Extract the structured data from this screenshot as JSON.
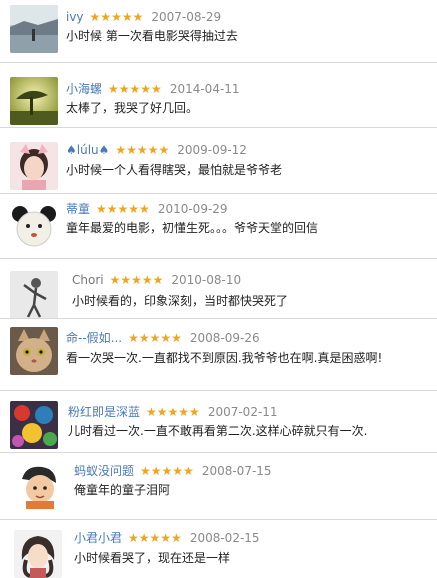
{
  "reviews": [
    {
      "user": "ivy",
      "stars": "★★★★★",
      "date": "2007-08-29",
      "comment": "小时候 第一次看电影哭得抽过去",
      "avatar": "landscape-avatar"
    },
    {
      "user": "小海螺",
      "stars": "★★★★★",
      "date": "2014-04-11",
      "comment": "太棒了，我哭了好几回。",
      "avatar": "tree-sunset-avatar"
    },
    {
      "user": "♠lúlu♠",
      "stars": "★★★★★",
      "date": "2009-09-12",
      "comment": "小时候一个人看得瞎哭，最怕就是爷爷老",
      "avatar": "girl-avatar"
    },
    {
      "user": "蒂童",
      "stars": "★★★★★",
      "date": "2010-09-29",
      "comment": "童年最爱的电影，初懂生死。。。爷爷天堂的回信",
      "avatar": "panda-doll-avatar"
    },
    {
      "user": "Chori",
      "stars": "★★★★★",
      "date": "2010-08-10",
      "comment": "小时候看的，印象深刻，当时都快哭死了",
      "avatar": "figure-avatar"
    },
    {
      "user": "命--假如...",
      "stars": "★★★★★",
      "date": "2008-09-26",
      "comment": "看一次哭一次.一直都找不到原因.我爷爷也在啊.真是困惑啊!",
      "avatar": "cat-avatar"
    },
    {
      "user": "粉红即是深蓝",
      "stars": "★★★★★",
      "date": "2007-02-11",
      "comment": "儿时看过一次.一直不敢再看第二次.这样心碎就只有一次.",
      "avatar": "colorful-avatar"
    },
    {
      "user": "蚂蚁没问题",
      "stars": "★★★★★",
      "date": "2008-07-15",
      "comment": "俺童年的童子泪阿",
      "avatar": "cartoon-boy-avatar"
    },
    {
      "user": "小君小君",
      "stars": "★★★★★",
      "date": "2008-02-15",
      "comment": "小时候看哭了，现在还是一样",
      "avatar": "girl-drawing-avatar"
    }
  ]
}
